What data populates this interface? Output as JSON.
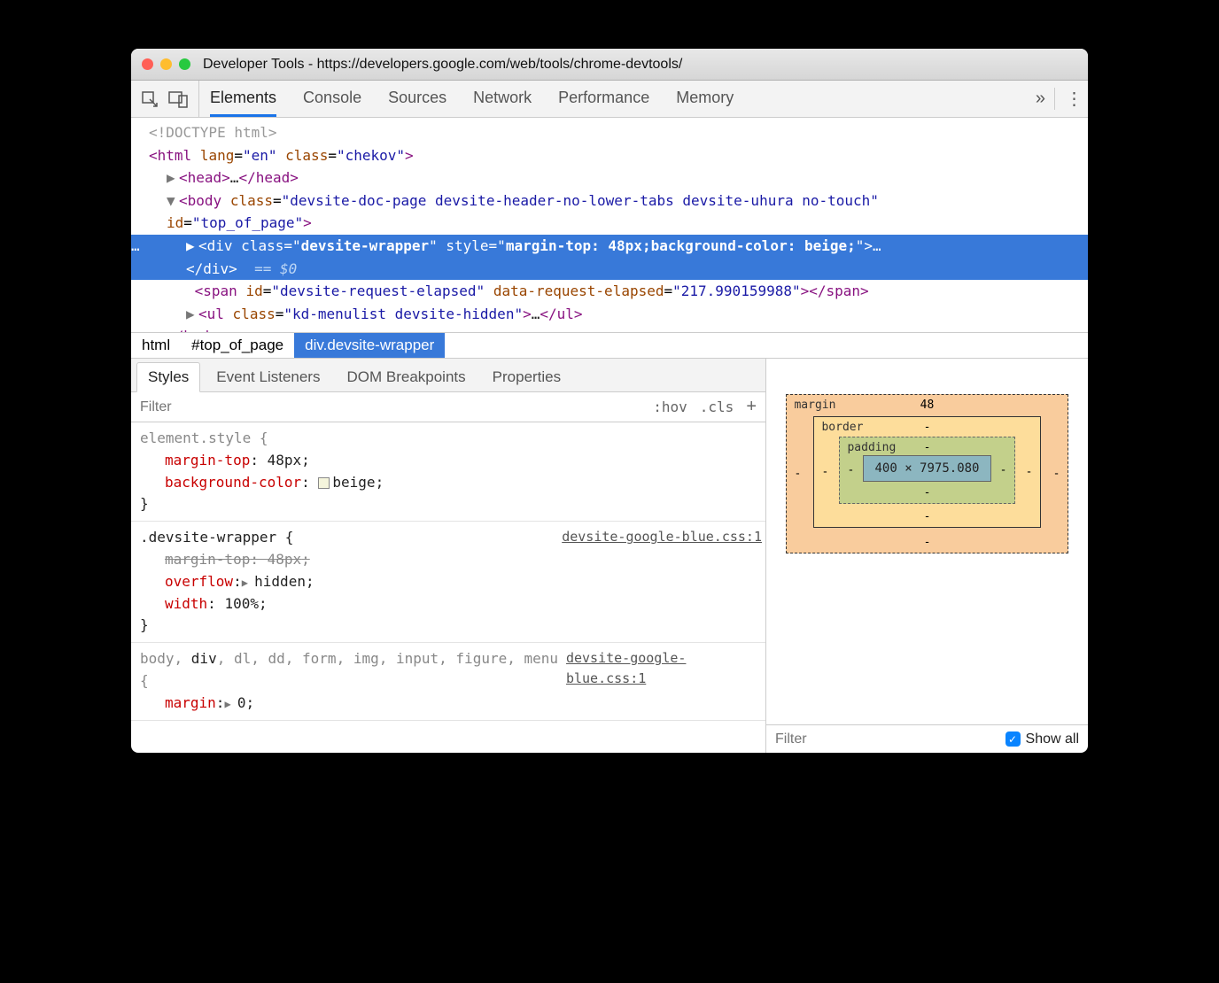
{
  "window": {
    "title": "Developer Tools - https://developers.google.com/web/tools/chrome-devtools/"
  },
  "tabs": [
    "Elements",
    "Console",
    "Sources",
    "Network",
    "Performance",
    "Memory"
  ],
  "dom": {
    "doctype": "<!DOCTYPE html>",
    "html_open": "<html lang=\"en\" class=\"chekov\">",
    "head": "<head>…</head>",
    "body_open_1": "<body class=\"devsite-doc-page devsite-header-no-lower-tabs devsite-uhura no-touch\"",
    "body_open_2": "id=\"top_of_page\">",
    "selected_1": "<div class=\"devsite-wrapper\" style=\"margin-top: 48px;background-color: beige;\">…",
    "selected_2": "</div>",
    "eq0": "== $0",
    "span_line": "<span id=\"devsite-request-elapsed\" data-request-elapsed=\"217.990159988\"></span>",
    "ul_line": "<ul class=\"kd-menulist devsite-hidden\">…</ul>",
    "body_close": "</body>"
  },
  "breadcrumbs": [
    "html",
    "#top_of_page",
    "div.devsite-wrapper"
  ],
  "subtabs": [
    "Styles",
    "Event Listeners",
    "DOM Breakpoints",
    "Properties"
  ],
  "filter": {
    "placeholder": "Filter",
    "hov": ":hov",
    "cls": ".cls"
  },
  "styles": {
    "rule1": {
      "selector": "element.style {",
      "decl1_prop": "margin-top",
      "decl1_val": "48px",
      "decl2_prop": "background-color",
      "decl2_val": "beige",
      "close": "}"
    },
    "rule2": {
      "selector": ".devsite-wrapper {",
      "source": "devsite-google-blue.css:1",
      "decl1_prop": "margin-top",
      "decl1_val": "48px",
      "decl2_prop": "overflow",
      "decl2_val": "hidden",
      "decl3_prop": "width",
      "decl3_val": "100%",
      "close": "}"
    },
    "rule3": {
      "selector": "body, div, dl, dd, form, img, input, figure, menu {",
      "source": "devsite-google-blue.css:1",
      "decl1_prop": "margin",
      "decl1_val": "0",
      "close": ""
    }
  },
  "box_model": {
    "margin_label": "margin",
    "margin_top": "48",
    "border_label": "border",
    "padding_label": "padding",
    "content": "400 × 7975.080",
    "dash": "-"
  },
  "computed": {
    "filter_placeholder": "Filter",
    "show_all": "Show all"
  }
}
